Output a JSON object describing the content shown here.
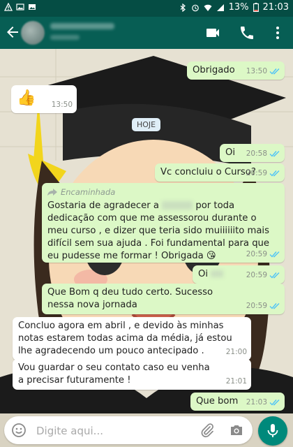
{
  "status_bar": {
    "battery": "13%",
    "time": "21:03",
    "icons": [
      "warning-icon",
      "image-icon",
      "image-icon",
      "bluetooth-icon",
      "alarm-icon",
      "wifi-icon",
      "signal-icon",
      "battery-icon"
    ]
  },
  "header": {
    "icons": [
      "back-arrow-icon",
      "video-call-icon",
      "phone-icon",
      "more-options-icon"
    ]
  },
  "date_chip": "HOJE",
  "messages": [
    {
      "dir": "out",
      "text": "Obrigado",
      "time": "13:50",
      "read": true
    },
    {
      "dir": "in",
      "text": "👍",
      "time": "13:50"
    },
    {
      "dir": "out",
      "text": "Oi",
      "time": "20:58",
      "read": true
    },
    {
      "dir": "out",
      "text": "Vc concluiu o Curso?",
      "time": "20:59",
      "read": true
    },
    {
      "dir": "out",
      "forwarded_label": "Encaminhada",
      "text_a": "Gostaria de agradecer a",
      "text_b": "por toda dedicação  com que me assessorou durante o meu curso , e dizer que teria sido muiiiiiito mais difícil sem sua ajuda . Foi fundamental para que eu pudesse me formar ! Obrigada 😘",
      "time": "20:59",
      "read": true
    },
    {
      "dir": "out",
      "text": "Oi",
      "time": "20:59",
      "read": true
    },
    {
      "dir": "out",
      "text": "Que Bom q deu tudo certo. Sucesso nessa nova jornada",
      "time": "20:59",
      "read": true
    },
    {
      "dir": "in",
      "text": "Concluo agora em abril , e devido às minhas notas estarem todas acima da média, já estou lhe agradecendo um pouco antecipado .",
      "time": "21:00"
    },
    {
      "dir": "in",
      "text": "Vou guardar o seu contato caso eu venha a precisar futuramente !",
      "time": "21:01"
    },
    {
      "dir": "out",
      "text": "Que bom",
      "time": "21:03",
      "read": true
    }
  ],
  "input": {
    "placeholder": "Digite aqui..."
  },
  "colors": {
    "header": "#075e54",
    "status_bar": "#054d44",
    "outgoing_bubble": "#dcf8c6",
    "incoming_bubble": "#ffffff",
    "read_ticks": "#4fc3f7",
    "mic_button": "#00897b"
  }
}
